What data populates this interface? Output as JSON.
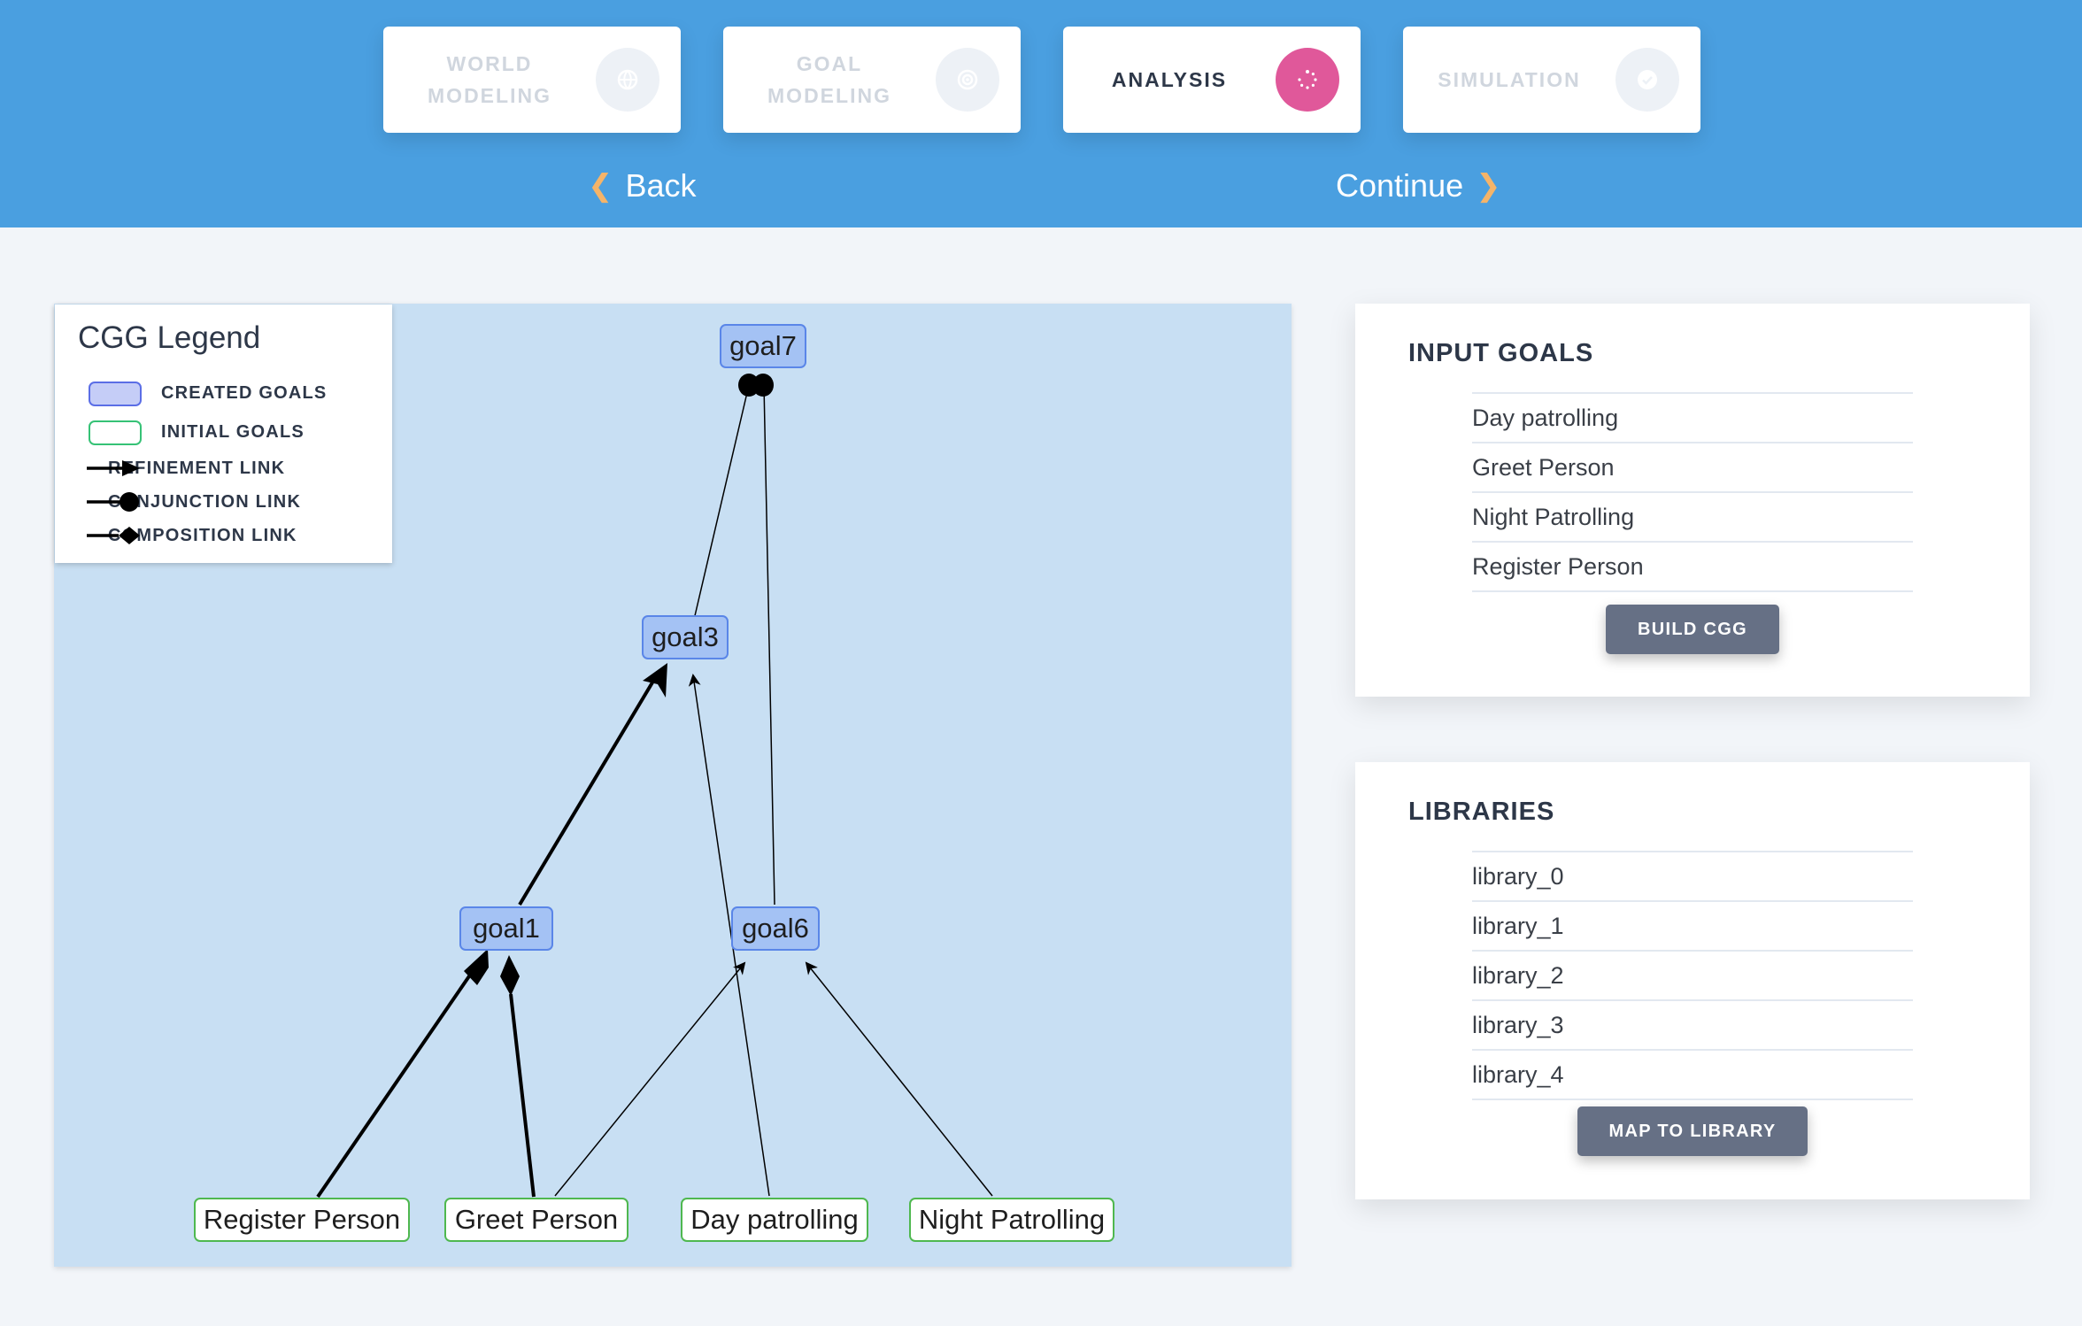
{
  "header": {
    "steps": [
      {
        "label": "WORLD\nMODELING",
        "icon": "globe-icon",
        "active": false
      },
      {
        "label": "GOAL\nMODELING",
        "icon": "target-icon",
        "active": false
      },
      {
        "label": "ANALYSIS",
        "icon": "spinner-icon",
        "active": true
      },
      {
        "label": "SIMULATION",
        "icon": "check-icon",
        "active": false
      }
    ],
    "back_label": "Back",
    "continue_label": "Continue"
  },
  "legend": {
    "title": "CGG Legend",
    "items": [
      {
        "label": "CREATED GOALS",
        "kind": "created-swatch"
      },
      {
        "label": "INITIAL GOALS",
        "kind": "initial-swatch"
      },
      {
        "label": "REFINEMENT LINK",
        "kind": "arrow"
      },
      {
        "label": "CONJUNCTION LINK",
        "kind": "circle"
      },
      {
        "label": "COMPOSITION LINK",
        "kind": "diamond"
      }
    ]
  },
  "graph": {
    "nodes": {
      "goal7": "goal7",
      "goal3": "goal3",
      "goal1": "goal1",
      "goal6": "goal6",
      "register": "Register Person",
      "greet": "Greet Person",
      "day": "Day patrolling",
      "night": "Night Patrolling"
    },
    "edges": [
      {
        "from": "goal3",
        "to": "goal7",
        "type": "conjunction"
      },
      {
        "from": "goal6",
        "to": "goal7",
        "type": "conjunction"
      },
      {
        "from": "goal1",
        "to": "goal3",
        "type": "refinement"
      },
      {
        "from": "day",
        "to": "goal3",
        "type": "refinement"
      },
      {
        "from": "register",
        "to": "goal1",
        "type": "composition"
      },
      {
        "from": "greet",
        "to": "goal1",
        "type": "composition"
      },
      {
        "from": "greet",
        "to": "goal6",
        "type": "refinement"
      },
      {
        "from": "night",
        "to": "goal6",
        "type": "refinement"
      }
    ]
  },
  "input_goals": {
    "title": "INPUT GOALS",
    "items": [
      "Day patrolling",
      "Greet Person",
      "Night Patrolling",
      "Register Person"
    ],
    "button": "BUILD CGG"
  },
  "libraries": {
    "title": "LIBRARIES",
    "items": [
      "library_0",
      "library_1",
      "library_2",
      "library_3",
      "library_4"
    ],
    "button": "MAP TO LIBRARY"
  },
  "colors": {
    "header": "#4a9fe0",
    "active_step": "#e0589a",
    "graph_bg": "#c8dff3",
    "created_goal": "#a4c2f4",
    "initial_goal_border": "#4fb84f",
    "button": "#667085"
  }
}
